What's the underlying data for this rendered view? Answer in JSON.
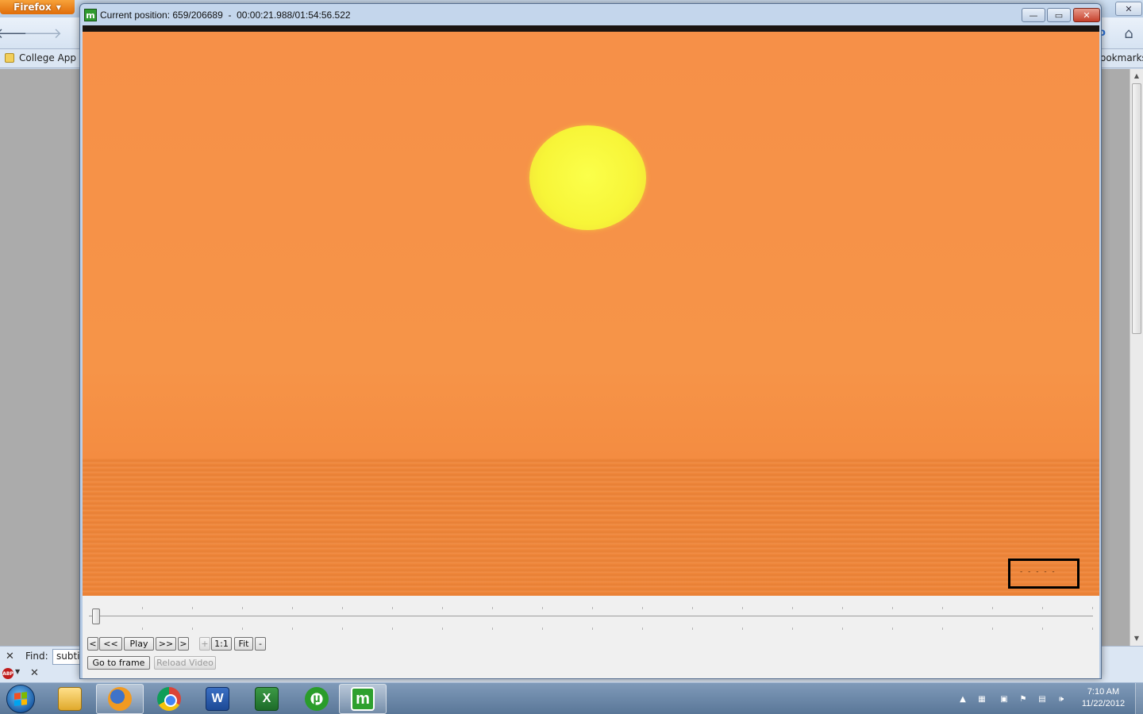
{
  "firefox": {
    "menu_label": "Firefox",
    "bookmarks": {
      "folder": "College App",
      "right_label": "ookmarks"
    },
    "find": {
      "label": "Find:",
      "value": "subti"
    }
  },
  "player": {
    "title": "Current position: 659/206689  -  00:00:21.988/01:54:56.522",
    "position_frame": 659,
    "total_frames": 206689,
    "current_time": "00:00:21.988",
    "duration": "01:54:56.522",
    "controls": {
      "prev_frame": "<",
      "rewind": "<<",
      "play": "Play",
      "fast_forward": ">>",
      "next_frame": ">",
      "zoom_in": "+",
      "actual_size": "1:1",
      "fit": "Fit",
      "zoom_out": "-",
      "go_to_frame": "Go to frame",
      "reload_video": "Reload Video"
    },
    "subtitle_fragment": "- - - -  -"
  },
  "taskbar": {
    "items": [
      {
        "name": "windows-explorer",
        "icon": "folder-icon"
      },
      {
        "name": "firefox",
        "icon": "firefox-icon",
        "active": true
      },
      {
        "name": "chrome",
        "icon": "chrome-icon"
      },
      {
        "name": "word",
        "icon": "word-icon",
        "glyph": "W"
      },
      {
        "name": "excel",
        "icon": "excel-icon",
        "glyph": "X"
      },
      {
        "name": "utorrent",
        "icon": "utorrent-icon",
        "glyph": "µ"
      },
      {
        "name": "media-player",
        "icon": "media-player-icon",
        "glyph": "m",
        "active": true
      }
    ],
    "clock_time": "7:10 AM",
    "clock_date": "11/22/2012"
  },
  "colors": {
    "video_orange": "#f69048",
    "sun_yellow": "#f7f538",
    "taskbar_blue": "#5a7798",
    "firefox_orange": "#e06d0a"
  }
}
